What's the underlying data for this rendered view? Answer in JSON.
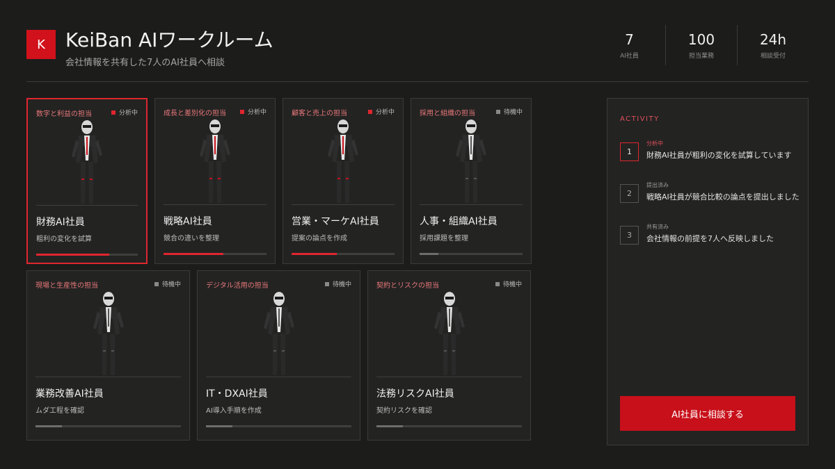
{
  "header": {
    "logo_letter": "K",
    "title": "KeiBan AIワークルーム",
    "subtitle": "会社情報を共有した7人のAI社員へ相談"
  },
  "stats": [
    {
      "value": "7",
      "label": "AI社員"
    },
    {
      "value": "100",
      "label": "担当業務"
    },
    {
      "value": "24h",
      "label": "相談受付"
    }
  ],
  "agents": [
    {
      "category": "数字と利益の担当",
      "status": "分析中",
      "active": true,
      "name": "財務AI社員",
      "task": "粗利の変化を試算",
      "progress": 0.72,
      "selected": true
    },
    {
      "category": "成長と差別化の担当",
      "status": "分析中",
      "active": true,
      "name": "戦略AI社員",
      "task": "競合の違いを整理",
      "progress": 0.58,
      "selected": false
    },
    {
      "category": "顧客と売上の担当",
      "status": "分析中",
      "active": true,
      "name": "営業・マーケAI社員",
      "task": "提案の論点を作成",
      "progress": 0.44,
      "selected": false
    },
    {
      "category": "採用と組織の担当",
      "status": "待機中",
      "active": false,
      "name": "人事・組織AI社員",
      "task": "採用課題を整理",
      "progress": 0.18,
      "selected": false
    },
    {
      "category": "現場と生産性の担当",
      "status": "待機中",
      "active": false,
      "name": "業務改善AI社員",
      "task": "ムダ工程を確認",
      "progress": 0.18,
      "selected": false
    },
    {
      "category": "デジタル活用の担当",
      "status": "待機中",
      "active": false,
      "name": "IT・DXAI社員",
      "task": "AI導入手順を作成",
      "progress": 0.18,
      "selected": false
    },
    {
      "category": "契約とリスクの担当",
      "status": "待機中",
      "active": false,
      "name": "法務リスクAI社員",
      "task": "契約リスクを確認",
      "progress": 0.18,
      "selected": false
    }
  ],
  "activity": {
    "title": "ACTIVITY",
    "items": [
      {
        "num": "1",
        "status": "分析中",
        "active": true,
        "text": "財務AI社員が粗利の変化を試算しています"
      },
      {
        "num": "2",
        "status": "提出済み",
        "active": false,
        "text": "戦略AI社員が競合比較の論点を提出しました"
      },
      {
        "num": "3",
        "status": "共有済み",
        "active": false,
        "text": "会社情報の前提を7人へ反映しました"
      }
    ],
    "cta_label": "AI社員に相談する"
  },
  "colors": {
    "accent": "#e0262f",
    "cta": "#c8101a",
    "background": "#1c1c1b",
    "card": "#232322"
  }
}
